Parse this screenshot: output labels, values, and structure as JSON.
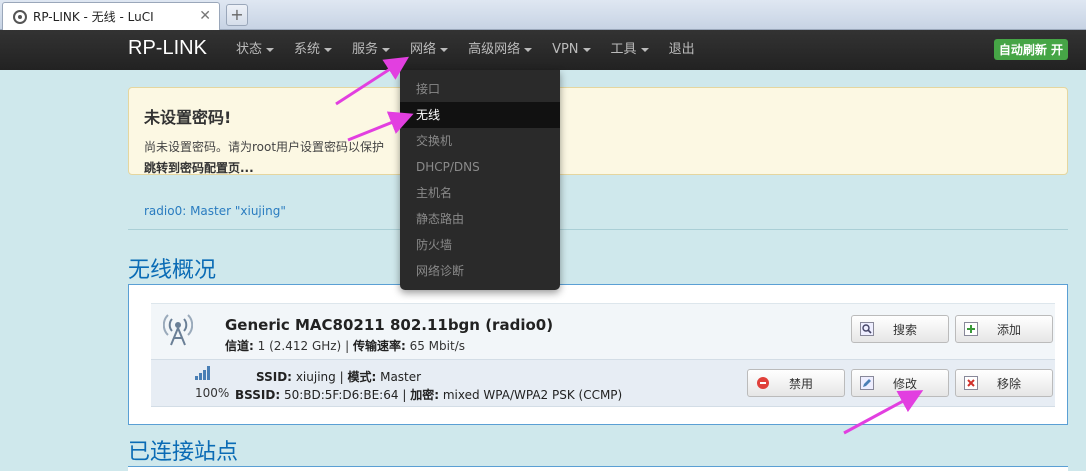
{
  "browser": {
    "tab_title": "RP-LINK - 无线 - LuCI",
    "close_glyph": "✕",
    "newtab_glyph": "+"
  },
  "navbar": {
    "brand": "RP-LINK",
    "menu": [
      {
        "label": "状态",
        "caret": true
      },
      {
        "label": "系统",
        "caret": true
      },
      {
        "label": "服务",
        "caret": true
      },
      {
        "label": "网络",
        "caret": true
      },
      {
        "label": "高级网络",
        "caret": true
      },
      {
        "label": "VPN",
        "caret": true
      },
      {
        "label": "工具",
        "caret": true
      },
      {
        "label": "退出",
        "caret": false
      }
    ],
    "auto_refresh": "自动刷新 开"
  },
  "network_dropdown": {
    "items": [
      {
        "label": "接口",
        "active": false
      },
      {
        "label": "无线",
        "active": true
      },
      {
        "label": "交换机",
        "active": false
      },
      {
        "label": "DHCP/DNS",
        "active": false
      },
      {
        "label": "主机名",
        "active": false
      },
      {
        "label": "静态路由",
        "active": false
      },
      {
        "label": "防火墙",
        "active": false
      },
      {
        "label": "网络诊断",
        "active": false
      }
    ]
  },
  "alert": {
    "title": "未设置密码!",
    "body": "尚未设置密码。请为root用户设置密码以保护",
    "link": "跳转到密码配置页..."
  },
  "radio_tab": "radio0: Master \"xiujing\"",
  "overview": {
    "title": "无线概况",
    "device": {
      "name": "Generic MAC80211 802.11bgn (radio0)",
      "channel_label": "信道:",
      "channel_value": "1 (2.412 GHz)",
      "sep": "|",
      "rate_label": "传输速率:",
      "rate_value": "65 Mbit/s",
      "buttons": {
        "scan": "搜索",
        "add": "添加"
      }
    },
    "network": {
      "signal_percent": "100%",
      "ssid_label": "SSID:",
      "ssid_value": "xiujing",
      "mode_label": "模式:",
      "mode_value": "Master",
      "bssid_label": "BSSID:",
      "bssid_value": "50:BD:5F:D6:BE:64",
      "enc_label": "加密:",
      "enc_value": "mixed WPA/WPA2 PSK (CCMP)",
      "buttons": {
        "disable": "禁用",
        "edit": "修改",
        "remove": "移除"
      }
    }
  },
  "connected_title": "已连接站点",
  "colors": {
    "navbar": "#222222",
    "accent_blue": "#0a6bb5",
    "annotation_arrow": "#e23fe0",
    "refresh_green": "#46a546"
  }
}
